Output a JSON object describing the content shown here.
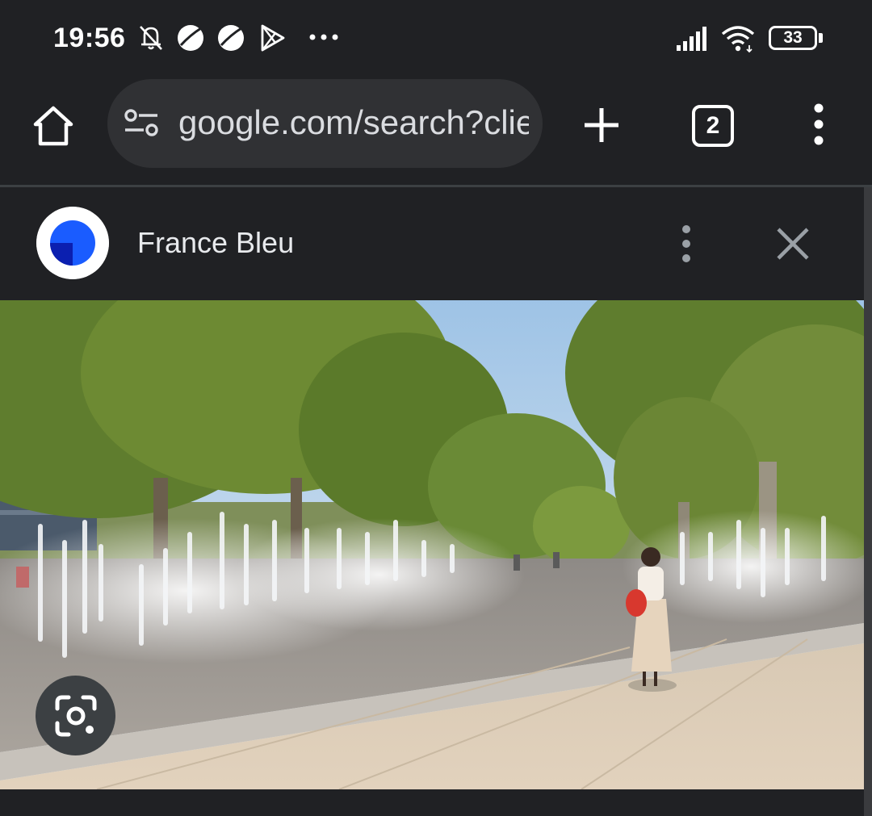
{
  "status_bar": {
    "time": "19:56",
    "left_icons": [
      "bell-off-icon",
      "planet-icon",
      "planet-icon",
      "play-store-icon",
      "more-dots-icon"
    ],
    "right_icons": [
      "signal-icon",
      "wifi-icon",
      "battery-icon"
    ],
    "battery_level": "33"
  },
  "toolbar": {
    "url": "google.com/search?client=ms-android",
    "tab_count": "2",
    "icons": [
      "home-icon",
      "tune-icon",
      "plus-icon",
      "tabs-icon",
      "kebab-menu-icon"
    ]
  },
  "sheet": {
    "source_name": "France Bleu",
    "icons": [
      "source-logo",
      "kebab-menu-icon",
      "close-icon",
      "lens-icon"
    ]
  },
  "colors": {
    "background": "#202124",
    "omnibox": "#303134",
    "text": "#e8eaed",
    "logo_blue": "#1a5cff",
    "logo_dark": "#0a1a9e"
  }
}
